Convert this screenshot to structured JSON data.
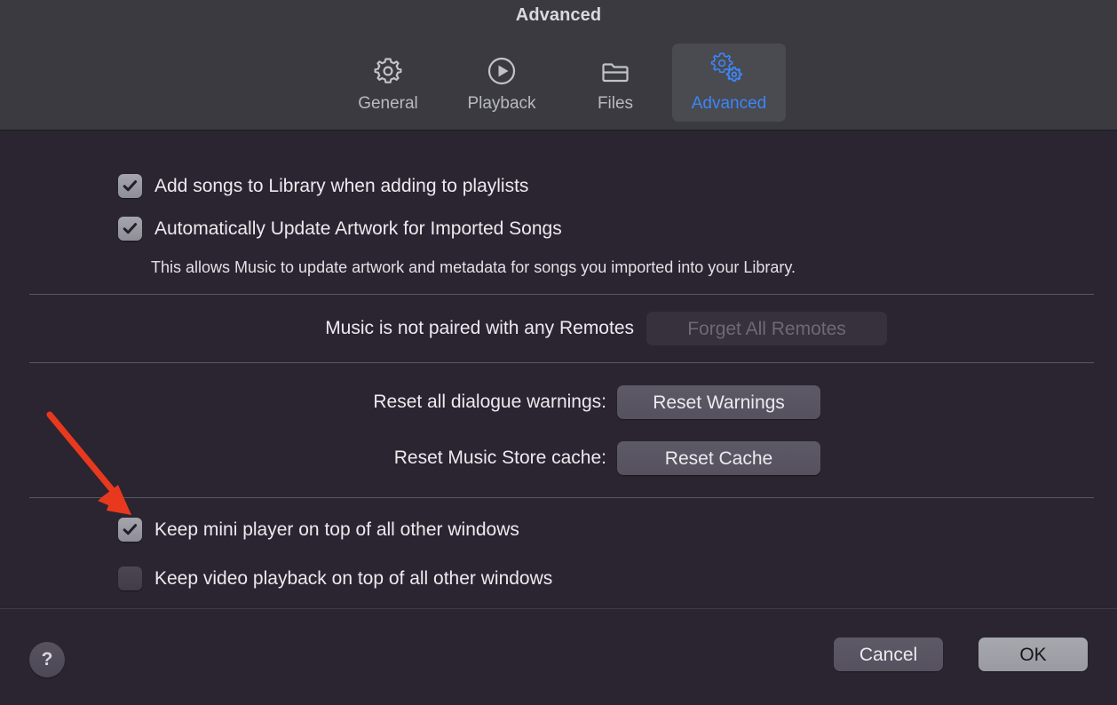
{
  "window": {
    "title": "Advanced"
  },
  "toolbar": {
    "tabs": [
      {
        "label": "General",
        "icon": "gear-icon",
        "selected": false
      },
      {
        "label": "Playback",
        "icon": "play-circle-icon",
        "selected": false
      },
      {
        "label": "Files",
        "icon": "folder-icon",
        "selected": false
      },
      {
        "label": "Advanced",
        "icon": "double-gear-icon",
        "selected": true
      }
    ]
  },
  "main": {
    "checkbox_add_songs": {
      "label": "Add songs to Library when adding to playlists",
      "checked": true
    },
    "checkbox_update_artwork": {
      "label": "Automatically Update Artwork for Imported Songs",
      "checked": true
    },
    "artwork_description": "This allows Music to update artwork and metadata for songs you imported into your Library.",
    "remotes": {
      "status_label": "Music is not paired with any Remotes",
      "button_label": "Forget All Remotes",
      "button_disabled": true
    },
    "reset_warnings": {
      "label": "Reset all dialogue warnings:",
      "button_label": "Reset Warnings"
    },
    "reset_cache": {
      "label": "Reset Music Store cache:",
      "button_label": "Reset Cache"
    },
    "checkbox_mini_player": {
      "label": "Keep mini player on top of all other windows",
      "checked": true
    },
    "checkbox_video_playback": {
      "label": "Keep video playback on top of all other windows",
      "checked": false
    }
  },
  "footer": {
    "help_label": "?",
    "cancel_label": "Cancel",
    "ok_label": "OK"
  },
  "colors": {
    "accent": "#3c86f5",
    "annotation": "#e8391e",
    "toolbar_bg": "#3a3a40",
    "body_bg": "#2a2530",
    "text": "#eceaef"
  }
}
